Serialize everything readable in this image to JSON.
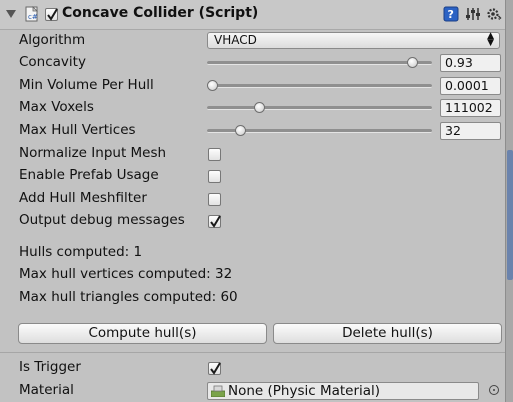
{
  "component": {
    "title": "Concave Collider (Script)",
    "enabled": true
  },
  "fields": {
    "algorithm": {
      "label": "Algorithm",
      "value": "VHACD",
      "arrows": "⬍"
    },
    "concavity": {
      "label": "Concavity",
      "value": "0.93",
      "fraction": 0.93
    },
    "min_volume": {
      "label": "Min Volume Per Hull",
      "value": "0.0001",
      "fraction": 0.0
    },
    "max_voxels": {
      "label": "Max Voxels",
      "value": "111002",
      "fraction": 0.22
    },
    "max_hull_vertices": {
      "label": "Max Hull Vertices",
      "value": "32",
      "fraction": 0.13
    },
    "normalize": {
      "label": "Normalize Input Mesh",
      "checked": false
    },
    "prefab": {
      "label": "Enable Prefab Usage",
      "checked": false
    },
    "meshfilter": {
      "label": "Add Hull Meshfilter",
      "checked": false
    },
    "debug": {
      "label": "Output debug messages",
      "checked": true
    }
  },
  "stats": {
    "hulls": "Hulls computed: 1",
    "vertices": "Max hull vertices computed: 32",
    "triangles": "Max hull triangles computed: 60"
  },
  "buttons": {
    "compute": "Compute hull(s)",
    "delete": "Delete hull(s)"
  },
  "is_trigger": {
    "label": "Is Trigger",
    "checked": true
  },
  "material": {
    "label": "Material",
    "value": "None (Physic Material)"
  },
  "colors": {
    "background": "#c2c2c2",
    "accent": "#2a5cb0"
  }
}
